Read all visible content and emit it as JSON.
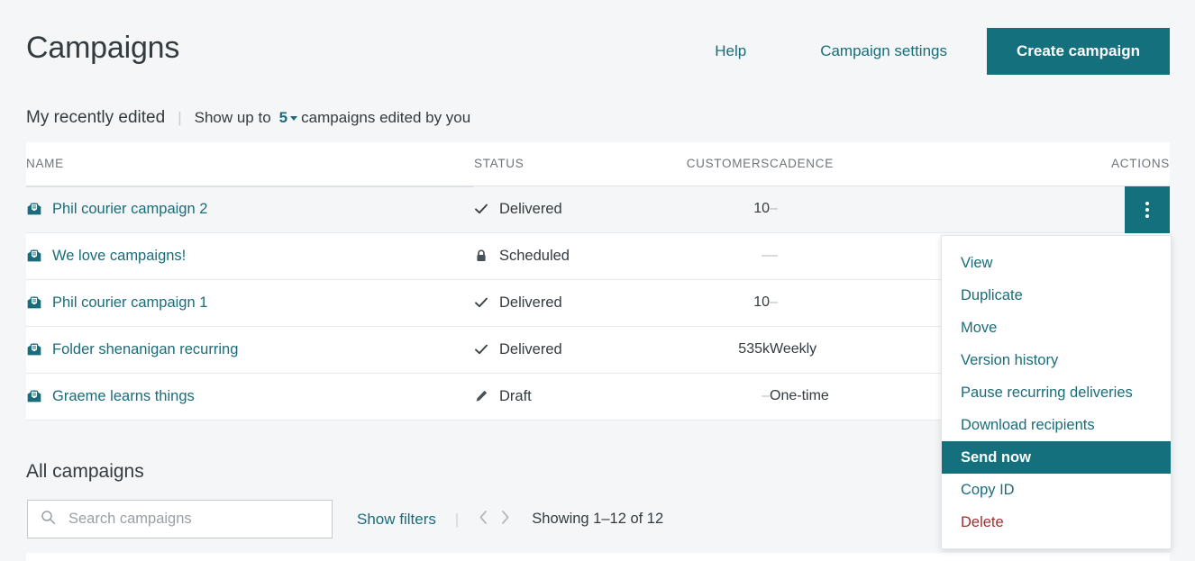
{
  "header": {
    "title": "Campaigns",
    "help_label": "Help",
    "settings_label": "Campaign settings",
    "create_label": "Create campaign",
    "accent_color": "#15707e"
  },
  "subheader": {
    "title": "My recently edited",
    "separator": "|",
    "prefix_text": "Show up to",
    "count_value": "5",
    "suffix_text": "campaigns edited by you"
  },
  "recent_table": {
    "columns": [
      "NAME",
      "STATUS",
      "CUSTOMERS",
      "CADENCE",
      "ACTIONS"
    ],
    "rows": [
      {
        "name": "Phil courier campaign 2",
        "status": "Delivered",
        "status_icon": "check-icon",
        "customers": "10",
        "cadence": "–"
      },
      {
        "name": "We love campaigns!",
        "status": "Scheduled",
        "status_icon": "lock-icon",
        "customers": "–",
        "cadence": "–"
      },
      {
        "name": "Phil courier campaign 1",
        "status": "Delivered",
        "status_icon": "check-icon",
        "customers": "10",
        "cadence": "–"
      },
      {
        "name": "Folder shenanigan recurring",
        "status": "Delivered",
        "status_icon": "check-icon",
        "customers": "535k",
        "cadence": "Weekly"
      },
      {
        "name": "Graeme learns things",
        "status": "Draft",
        "status_icon": "pencil-icon",
        "customers": "–",
        "cadence": "One-time"
      }
    ]
  },
  "actions_menu": {
    "items": [
      {
        "label": "View",
        "state": "normal"
      },
      {
        "label": "Duplicate",
        "state": "normal"
      },
      {
        "label": "Move",
        "state": "normal"
      },
      {
        "label": "Version history",
        "state": "normal"
      },
      {
        "label": "Pause recurring deliveries",
        "state": "normal"
      },
      {
        "label": "Download recipients",
        "state": "normal"
      },
      {
        "label": "Send now",
        "state": "selected"
      },
      {
        "label": "Copy ID",
        "state": "normal"
      },
      {
        "label": "Delete",
        "state": "danger"
      }
    ],
    "highlight_color": "#15707e",
    "danger_color": "#9e2f2f"
  },
  "all_campaigns": {
    "title": "All campaigns",
    "search_placeholder": "Search campaigns",
    "search_value": "",
    "show_filters_label": "Show filters",
    "separator": "|",
    "showing_text": "Showing 1–12 of 12"
  }
}
